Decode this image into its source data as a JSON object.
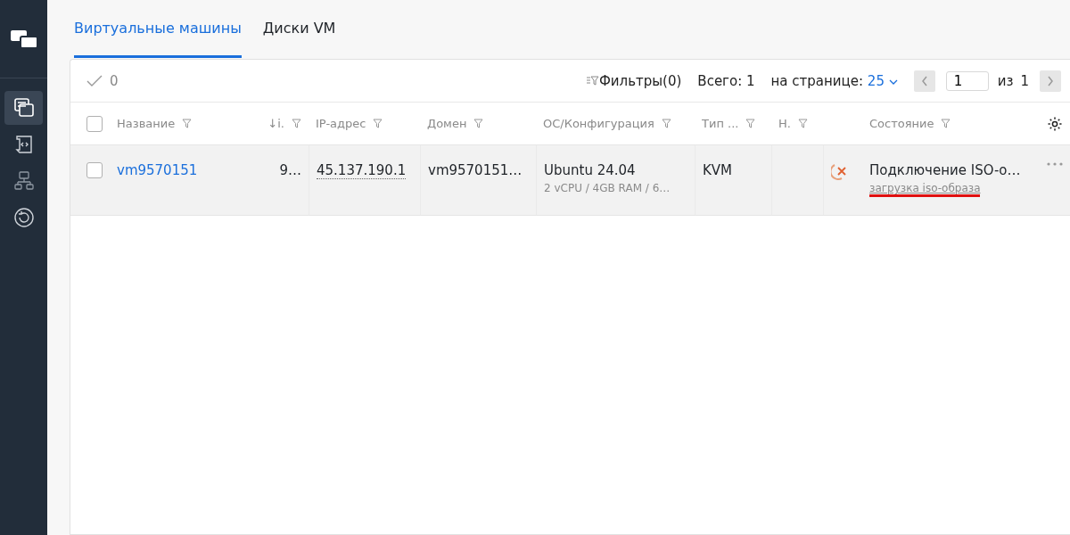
{
  "sidebar": {
    "items": [
      {
        "selected": true
      },
      {
        "selected": false
      },
      {
        "selected": false
      },
      {
        "selected": false
      }
    ]
  },
  "tabs": [
    {
      "label": "Виртуальные машины",
      "selected": true
    },
    {
      "label": "Диски VM",
      "selected": false
    }
  ],
  "toolbar": {
    "selected_count": "0",
    "filters": "Фильтры(0)",
    "total": "Всего: 1",
    "per_page_label": "на странице:",
    "per_page": "25",
    "page": "1",
    "of": "из",
    "pages": "1"
  },
  "table": {
    "select_all_checked": false,
    "columns": [
      {
        "label": "Название"
      },
      {
        "label": "↓i."
      },
      {
        "label": "IP-адрес"
      },
      {
        "label": "Домен"
      },
      {
        "label": "ОС/Конфигурация"
      },
      {
        "label": "Тип ..."
      },
      {
        "label": "Н."
      },
      {
        "label": "Состояние"
      }
    ],
    "rows": [
      {
        "checked": false,
        "name": "vm9570151",
        "id": "9…",
        "ip": "45.137.190.1",
        "domain": "vm9570151…",
        "os": "Ubuntu 24.04",
        "config": "2 vCPU / 4GB RAM / 6…",
        "type": "KVM",
        "kind": "error",
        "state": "Подключение ISO-о…",
        "state_detail": "загрузка iso-образа",
        "underlined": true
      }
    ]
  }
}
